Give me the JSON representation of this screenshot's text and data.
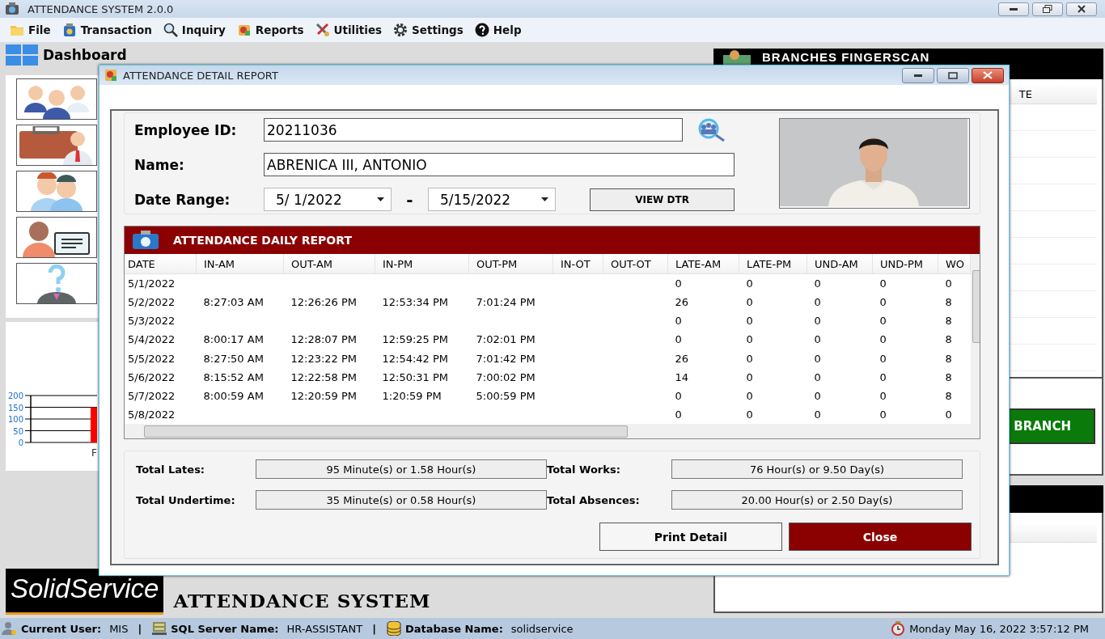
{
  "window": {
    "title": "ATTENDANCE SYSTEM 2.0.0"
  },
  "menu": [
    {
      "label": "File"
    },
    {
      "label": "Transaction"
    },
    {
      "label": "Inquiry"
    },
    {
      "label": "Reports"
    },
    {
      "label": "Utilities"
    },
    {
      "label": "Settings"
    },
    {
      "label": "Help"
    }
  ],
  "dashboard": {
    "title": "Dashboard",
    "chart_data": {
      "type": "bar",
      "categories": [
        "F"
      ],
      "series": [
        {
          "color": "#ff0000",
          "values": [
            150
          ]
        }
      ],
      "ylim": [
        0,
        200
      ],
      "yticks": [
        0,
        50,
        100,
        150,
        200
      ],
      "grid": true
    }
  },
  "branches": {
    "title": "BRANCHES FINGERSCAN",
    "column": "TE",
    "button": "BRANCH"
  },
  "dialog": {
    "title": "ATTENDANCE DETAIL REPORT",
    "employee_id_label": "Employee ID:",
    "employee_id": "20211036",
    "name_label": "Name:",
    "name": "ABRENICA III, ANTONIO",
    "date_range_label": "Date Range:",
    "date_from": "5/ 1/2022",
    "separator": "-",
    "date_to": "5/15/2022",
    "view_button": "VIEW DTR",
    "report_title": "ATTENDANCE DAILY REPORT",
    "columns": [
      "DATE",
      "IN-AM",
      "OUT-AM",
      "IN-PM",
      "OUT-PM",
      "IN-OT",
      "OUT-OT",
      "LATE-AM",
      "LATE-PM",
      "UND-AM",
      "UND-PM",
      "WO"
    ],
    "rows": [
      [
        "5/1/2022",
        null,
        null,
        null,
        null,
        null,
        null,
        "0",
        "0",
        "0",
        "0",
        "0"
      ],
      [
        "5/2/2022",
        "8:27:03 AM",
        "12:26:26 PM",
        "12:53:34 PM",
        "7:01:24 PM",
        null,
        null,
        "26",
        "0",
        "0",
        "0",
        "8"
      ],
      [
        "5/3/2022",
        null,
        null,
        null,
        null,
        null,
        null,
        "0",
        "0",
        "0",
        "0",
        "8"
      ],
      [
        "5/4/2022",
        "8:00:17 AM",
        "12:28:07 PM",
        "12:59:25 PM",
        "7:02:01 PM",
        null,
        null,
        "0",
        "0",
        "0",
        "0",
        "8"
      ],
      [
        "5/5/2022",
        "8:27:50 AM",
        "12:23:22 PM",
        "12:54:42 PM",
        "7:01:42 PM",
        null,
        null,
        "26",
        "0",
        "0",
        "0",
        "8"
      ],
      [
        "5/6/2022",
        "8:15:52 AM",
        "12:22:58 PM",
        "12:50:31 PM",
        "7:00:02 PM",
        null,
        null,
        "14",
        "0",
        "0",
        "0",
        "8"
      ],
      [
        "5/7/2022",
        "8:00:59 AM",
        "12:20:59 PM",
        "1:20:59 PM",
        "5:00:59 PM",
        null,
        null,
        "0",
        "0",
        "0",
        "0",
        "8"
      ],
      [
        "5/8/2022",
        null,
        null,
        null,
        null,
        null,
        null,
        "0",
        "0",
        "0",
        "0",
        "0"
      ]
    ],
    "totals": [
      {
        "label": "Total Lates:",
        "value": "95 Minute(s) or 1.58 Hour(s)"
      },
      {
        "label": "Total Works:",
        "value": "76 Hour(s) or 9.50 Day(s)"
      },
      {
        "label": "Total Undertime:",
        "value": "35 Minute(s) or 0.58 Hour(s)"
      },
      {
        "label": "Total Absences:",
        "value": "20.00 Hour(s) or 2.50 Day(s)"
      }
    ],
    "buttons": [
      {
        "label": "Print Detail",
        "kind": "default"
      },
      {
        "label": "Close",
        "kind": "danger"
      }
    ]
  },
  "logo": {
    "brand": "SolidService",
    "subtitle": "ATTENDANCE SYSTEM"
  },
  "status_bar": {
    "items": [
      {
        "label": "Current User:",
        "value": "MIS"
      },
      {
        "label": "SQL Server Name:",
        "value": "HR-ASSISTANT"
      },
      {
        "label": "Database Name:",
        "value": "solidservice"
      }
    ],
    "dividers": [
      "|",
      "|"
    ],
    "datetime": "Monday May 16, 2022 3:57:12 PM"
  }
}
